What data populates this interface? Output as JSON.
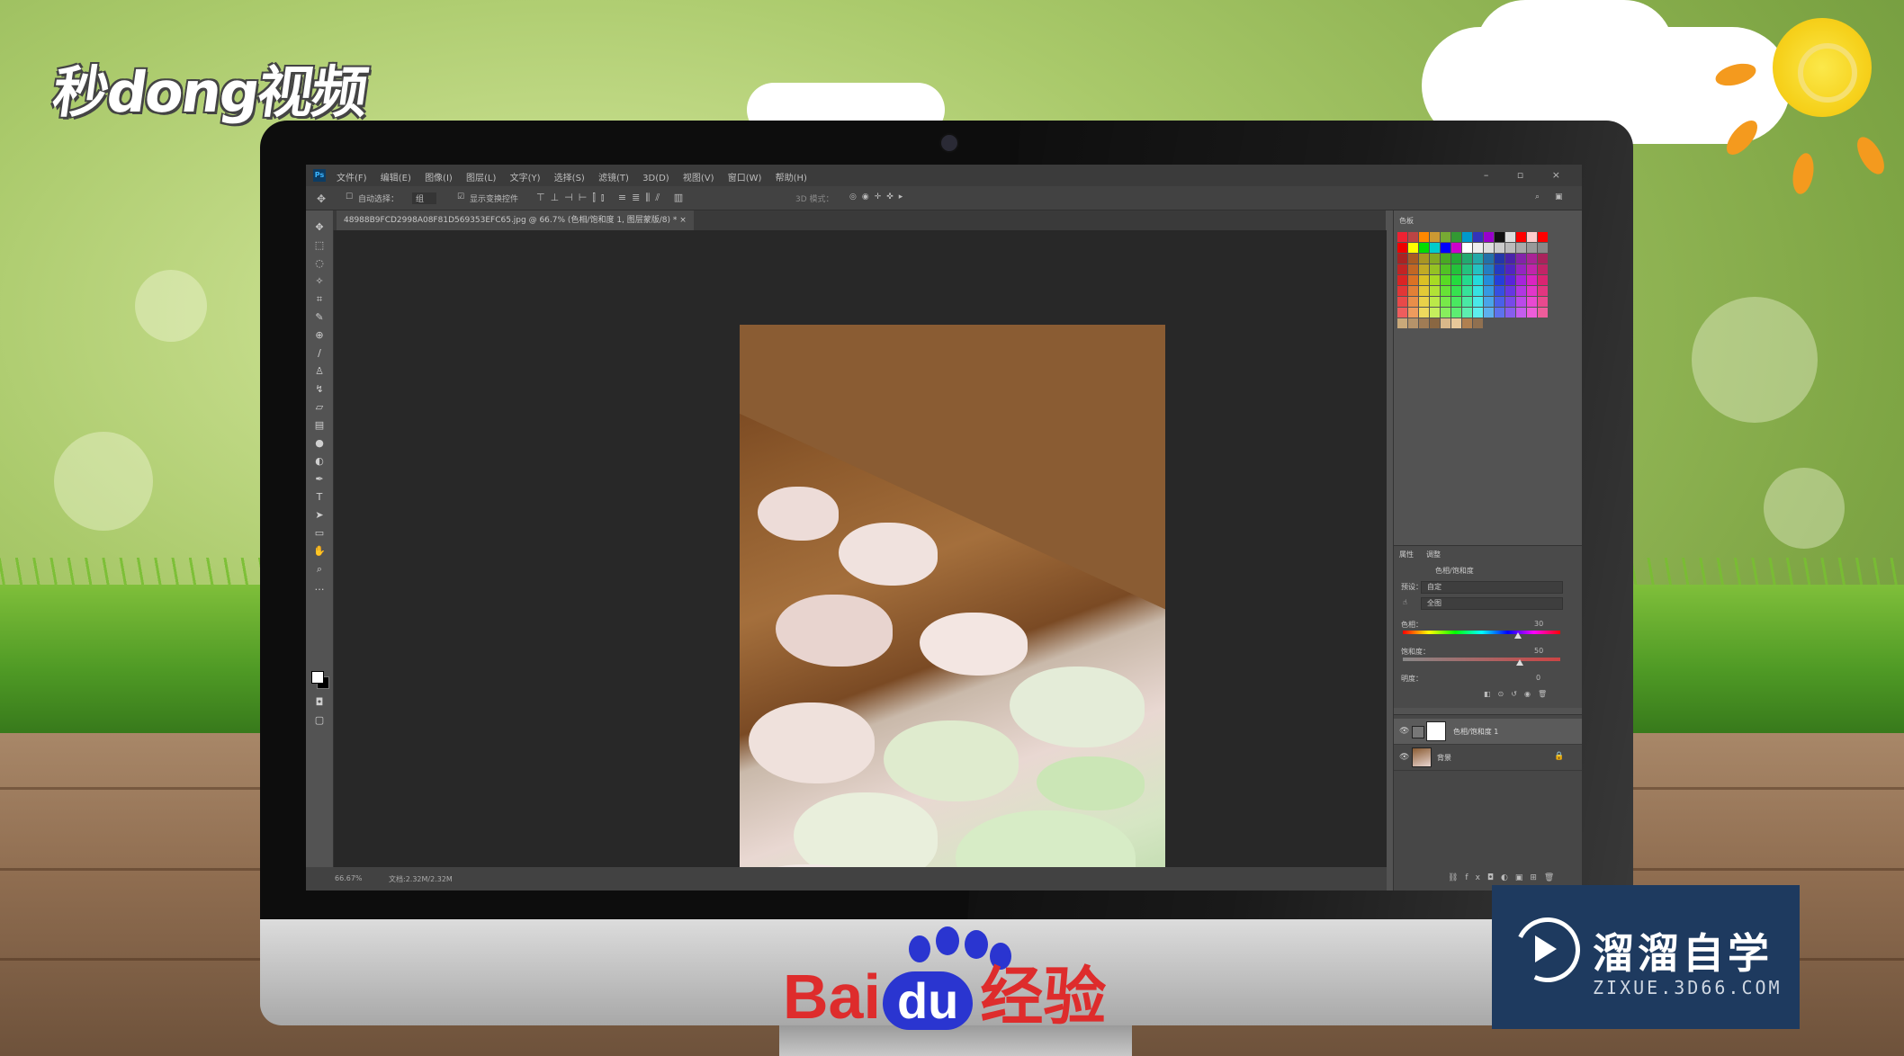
{
  "branding": {
    "channel_logo": "秒dong视频",
    "baidu_bai": "Bai",
    "baidu_du": "du",
    "baidu_jingyan": "经验",
    "watermark_title": "溜溜自学",
    "watermark_sub": "ZIXUE.3D66.COM"
  },
  "photoshop": {
    "app_icon": "Ps",
    "menus": [
      "文件(F)",
      "编辑(E)",
      "图像(I)",
      "图层(L)",
      "文字(Y)",
      "选择(S)",
      "滤镜(T)",
      "3D(D)",
      "视图(V)",
      "窗口(W)",
      "帮助(H)"
    ],
    "window_controls": "– ▫ ×",
    "options": {
      "auto_select_label": "自动选择：",
      "auto_select_value": "组",
      "transform_label": "显示变换控件",
      "mode_3d": "3D 模式："
    },
    "document_tab": "48988B9FCD2998A08F81D569353EFC65.jpg @ 66.7% (色相/饱和度 1, 图层蒙版/8) * ×",
    "status": {
      "zoom": "66.67%",
      "doc_size": "文档:2.32M/2.32M"
    },
    "panels": {
      "swatches_tab": "色板",
      "properties_tab": "属性",
      "adjustments_tab": "调整",
      "adjustment_name": "色相/饱和度",
      "preset_label": "预设：",
      "preset_value": "自定",
      "channel_value": "全图",
      "hue_label": "色相：",
      "hue_value": "30",
      "saturation_label": "饱和度：",
      "saturation_value": "50",
      "lightness_label": "明度：",
      "lightness_value": "0"
    },
    "layers": [
      {
        "name": "色相/饱和度 1",
        "selected": true
      },
      {
        "name": "背景",
        "selected": false
      }
    ]
  },
  "colors": {
    "ps_dark": "#282828",
    "ps_panel": "#535353",
    "baidu_red": "#de2c2c",
    "baidu_blue": "#2a35d0",
    "watermark_bg": "#1e3a5f"
  }
}
